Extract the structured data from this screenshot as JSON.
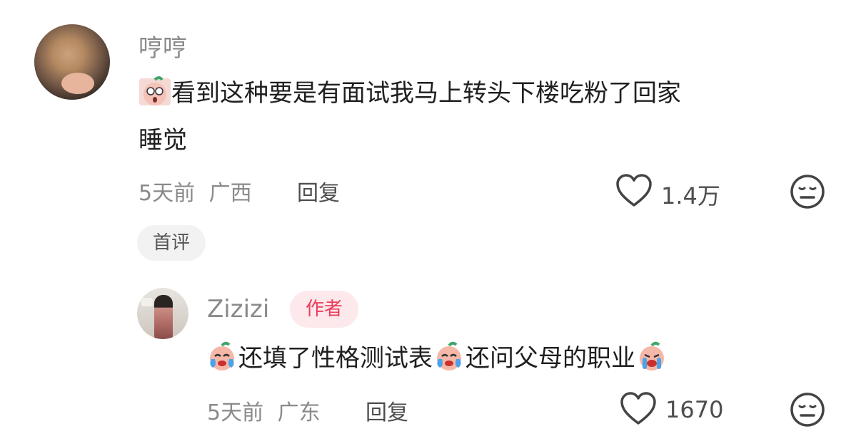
{
  "comment": {
    "username": "哼哼",
    "text_line1": "看到这种要是有面试我马上转头下楼吃粉了回家",
    "text_line2": "睡觉",
    "time": "5天前",
    "location": "广西",
    "reply_label": "回复",
    "likes": "1.4万",
    "badge": "首评"
  },
  "reply": {
    "username": "Zizizi",
    "author_badge": "作者",
    "text_part1": "还填了性格测试表",
    "text_part2": "还问父母的职业",
    "time": "5天前",
    "location": "广东",
    "reply_label": "回复",
    "likes": "1670"
  },
  "icons": {
    "like": "heart-outline-icon",
    "dislike": "meh-face-icon",
    "sticker": "peach-emoji-icon"
  },
  "colors": {
    "author_badge_text": "#ec3d5a",
    "author_badge_bg": "#fde8ec",
    "meta_text": "#8a8a8a"
  }
}
